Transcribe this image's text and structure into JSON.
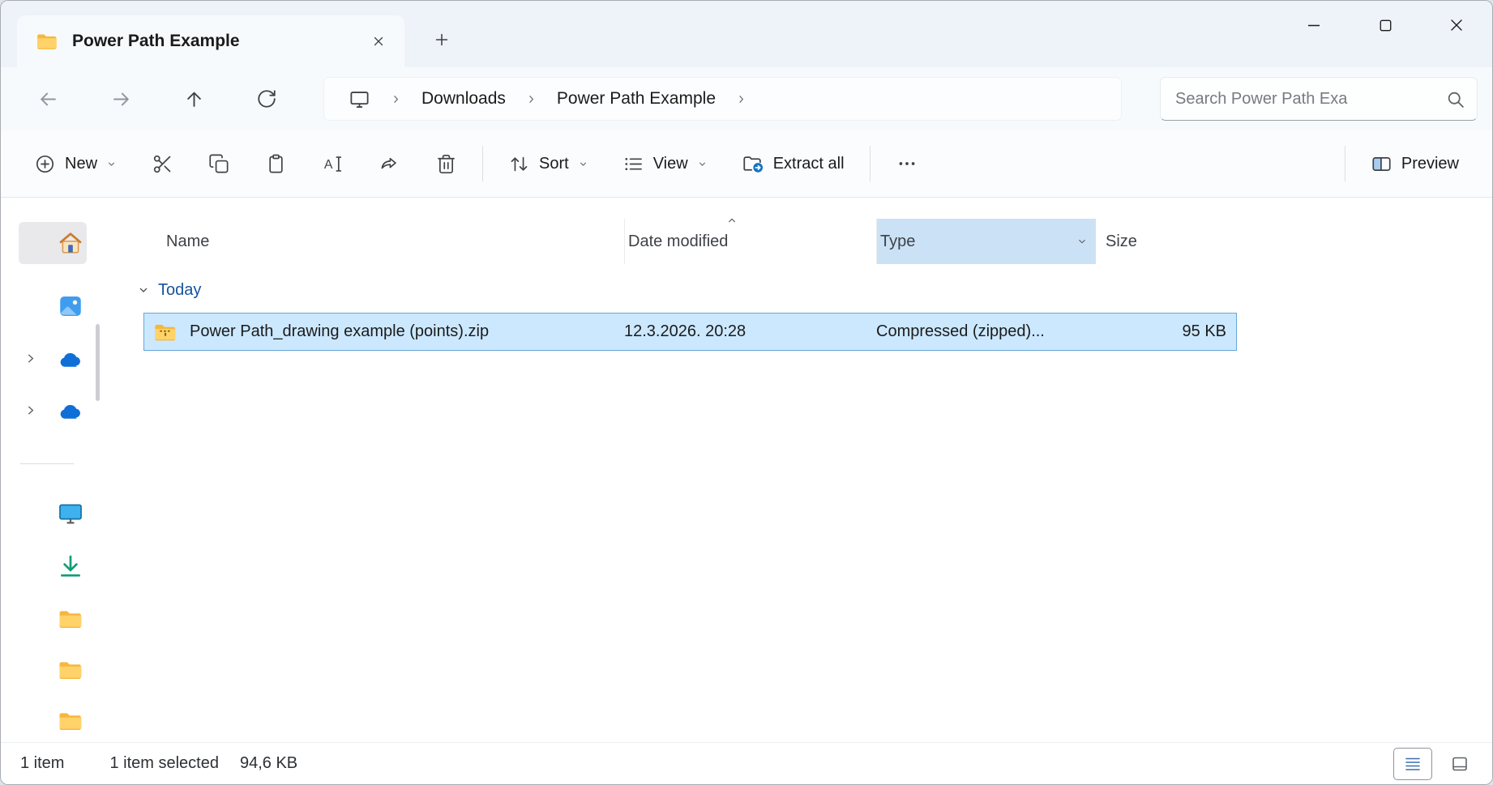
{
  "window": {
    "title": "Power Path Example"
  },
  "tabs": {
    "active_label": "Power Path Example"
  },
  "breadcrumb": {
    "items": [
      "Downloads",
      "Power Path Example"
    ]
  },
  "search": {
    "placeholder": "Search Power Path Exa"
  },
  "toolbar": {
    "new": "New",
    "sort": "Sort",
    "view": "View",
    "extract_all": "Extract all",
    "preview": "Preview"
  },
  "list": {
    "columns": {
      "name": "Name",
      "date_modified": "Date modified",
      "type": "Type",
      "size": "Size"
    },
    "group_label": "Today",
    "files": [
      {
        "name": "Power Path_drawing example (points).zip",
        "date_modified": "12.3.2026. 20:28",
        "type": "Compressed (zipped)...",
        "size": "95 KB",
        "selected": true
      }
    ]
  },
  "status": {
    "items": "1 item",
    "selected": "1 item selected",
    "size": "94,6 KB"
  },
  "icons": {
    "tab": "folder-icon",
    "navigation": [
      "back-icon",
      "forward-icon",
      "up-icon",
      "refresh-icon"
    ],
    "breadcrumb_root": "monitor-icon",
    "search": "search-icon",
    "toolbar": [
      "plus-circle-icon",
      "scissors-icon",
      "copy-icon",
      "paste-icon",
      "rename-icon",
      "share-icon",
      "trash-icon",
      "sort-icon",
      "view-lines-icon",
      "extract-zip-icon",
      "ellipsis-icon",
      "preview-pane-icon"
    ],
    "sidebar": [
      "home-icon",
      "gallery-icon",
      "onedrive-cloud-icon",
      "onedrive-cloud-icon",
      "monitor-icon",
      "downloads-arrow-icon",
      "folder-icon",
      "folder-icon",
      "folder-icon"
    ],
    "file": "zip-folder-icon",
    "statusbar": [
      "details-view-icon",
      "thumbnails-view-icon"
    ]
  },
  "colors": {
    "accent": "#1173c5",
    "selection_bg": "#cce8ff",
    "selection_border": "#66a7d8",
    "type_header_highlight": "#cbe2f6",
    "group_label": "#16529e"
  }
}
